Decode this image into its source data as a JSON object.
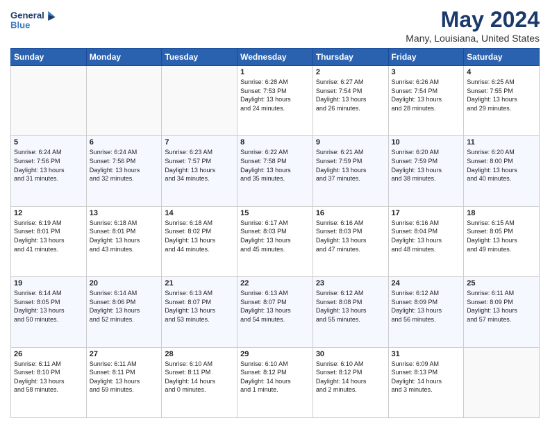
{
  "logo": {
    "line1": "General",
    "line2": "Blue"
  },
  "title": "May 2024",
  "subtitle": "Many, Louisiana, United States",
  "days": [
    "Sunday",
    "Monday",
    "Tuesday",
    "Wednesday",
    "Thursday",
    "Friday",
    "Saturday"
  ],
  "weeks": [
    [
      {
        "day": "",
        "content": ""
      },
      {
        "day": "",
        "content": ""
      },
      {
        "day": "",
        "content": ""
      },
      {
        "day": "1",
        "content": "Sunrise: 6:28 AM\nSunset: 7:53 PM\nDaylight: 13 hours\nand 24 minutes."
      },
      {
        "day": "2",
        "content": "Sunrise: 6:27 AM\nSunset: 7:54 PM\nDaylight: 13 hours\nand 26 minutes."
      },
      {
        "day": "3",
        "content": "Sunrise: 6:26 AM\nSunset: 7:54 PM\nDaylight: 13 hours\nand 28 minutes."
      },
      {
        "day": "4",
        "content": "Sunrise: 6:25 AM\nSunset: 7:55 PM\nDaylight: 13 hours\nand 29 minutes."
      }
    ],
    [
      {
        "day": "5",
        "content": "Sunrise: 6:24 AM\nSunset: 7:56 PM\nDaylight: 13 hours\nand 31 minutes."
      },
      {
        "day": "6",
        "content": "Sunrise: 6:24 AM\nSunset: 7:56 PM\nDaylight: 13 hours\nand 32 minutes."
      },
      {
        "day": "7",
        "content": "Sunrise: 6:23 AM\nSunset: 7:57 PM\nDaylight: 13 hours\nand 34 minutes."
      },
      {
        "day": "8",
        "content": "Sunrise: 6:22 AM\nSunset: 7:58 PM\nDaylight: 13 hours\nand 35 minutes."
      },
      {
        "day": "9",
        "content": "Sunrise: 6:21 AM\nSunset: 7:59 PM\nDaylight: 13 hours\nand 37 minutes."
      },
      {
        "day": "10",
        "content": "Sunrise: 6:20 AM\nSunset: 7:59 PM\nDaylight: 13 hours\nand 38 minutes."
      },
      {
        "day": "11",
        "content": "Sunrise: 6:20 AM\nSunset: 8:00 PM\nDaylight: 13 hours\nand 40 minutes."
      }
    ],
    [
      {
        "day": "12",
        "content": "Sunrise: 6:19 AM\nSunset: 8:01 PM\nDaylight: 13 hours\nand 41 minutes."
      },
      {
        "day": "13",
        "content": "Sunrise: 6:18 AM\nSunset: 8:01 PM\nDaylight: 13 hours\nand 43 minutes."
      },
      {
        "day": "14",
        "content": "Sunrise: 6:18 AM\nSunset: 8:02 PM\nDaylight: 13 hours\nand 44 minutes."
      },
      {
        "day": "15",
        "content": "Sunrise: 6:17 AM\nSunset: 8:03 PM\nDaylight: 13 hours\nand 45 minutes."
      },
      {
        "day": "16",
        "content": "Sunrise: 6:16 AM\nSunset: 8:03 PM\nDaylight: 13 hours\nand 47 minutes."
      },
      {
        "day": "17",
        "content": "Sunrise: 6:16 AM\nSunset: 8:04 PM\nDaylight: 13 hours\nand 48 minutes."
      },
      {
        "day": "18",
        "content": "Sunrise: 6:15 AM\nSunset: 8:05 PM\nDaylight: 13 hours\nand 49 minutes."
      }
    ],
    [
      {
        "day": "19",
        "content": "Sunrise: 6:14 AM\nSunset: 8:05 PM\nDaylight: 13 hours\nand 50 minutes."
      },
      {
        "day": "20",
        "content": "Sunrise: 6:14 AM\nSunset: 8:06 PM\nDaylight: 13 hours\nand 52 minutes."
      },
      {
        "day": "21",
        "content": "Sunrise: 6:13 AM\nSunset: 8:07 PM\nDaylight: 13 hours\nand 53 minutes."
      },
      {
        "day": "22",
        "content": "Sunrise: 6:13 AM\nSunset: 8:07 PM\nDaylight: 13 hours\nand 54 minutes."
      },
      {
        "day": "23",
        "content": "Sunrise: 6:12 AM\nSunset: 8:08 PM\nDaylight: 13 hours\nand 55 minutes."
      },
      {
        "day": "24",
        "content": "Sunrise: 6:12 AM\nSunset: 8:09 PM\nDaylight: 13 hours\nand 56 minutes."
      },
      {
        "day": "25",
        "content": "Sunrise: 6:11 AM\nSunset: 8:09 PM\nDaylight: 13 hours\nand 57 minutes."
      }
    ],
    [
      {
        "day": "26",
        "content": "Sunrise: 6:11 AM\nSunset: 8:10 PM\nDaylight: 13 hours\nand 58 minutes."
      },
      {
        "day": "27",
        "content": "Sunrise: 6:11 AM\nSunset: 8:11 PM\nDaylight: 13 hours\nand 59 minutes."
      },
      {
        "day": "28",
        "content": "Sunrise: 6:10 AM\nSunset: 8:11 PM\nDaylight: 14 hours\nand 0 minutes."
      },
      {
        "day": "29",
        "content": "Sunrise: 6:10 AM\nSunset: 8:12 PM\nDaylight: 14 hours\nand 1 minute."
      },
      {
        "day": "30",
        "content": "Sunrise: 6:10 AM\nSunset: 8:12 PM\nDaylight: 14 hours\nand 2 minutes."
      },
      {
        "day": "31",
        "content": "Sunrise: 6:09 AM\nSunset: 8:13 PM\nDaylight: 14 hours\nand 3 minutes."
      },
      {
        "day": "",
        "content": ""
      }
    ]
  ]
}
